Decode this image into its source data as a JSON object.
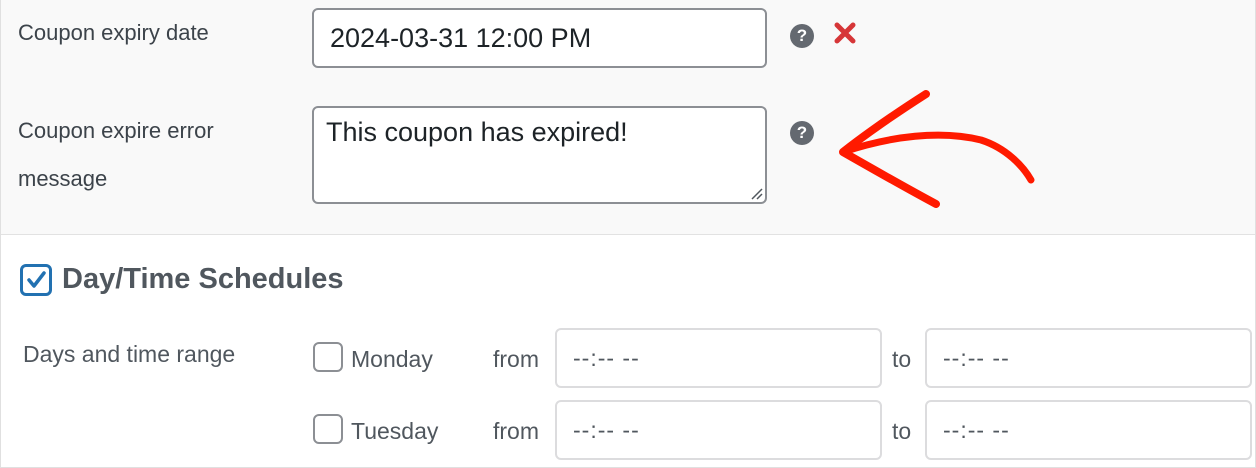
{
  "expiry": {
    "label": "Coupon expiry date",
    "value": "2024-03-31 12:00 PM",
    "help_icon": "question-circle-icon",
    "remove_icon": "red-x-icon"
  },
  "error_message": {
    "label_line1": "Coupon expire error",
    "label_line2": "message",
    "value": "This coupon has expired!",
    "help_icon": "question-circle-icon"
  },
  "schedule": {
    "title": "Day/Time Schedules",
    "enabled": true,
    "range_label": "Days and time range",
    "from_word": "from",
    "to_word": "to",
    "time_placeholder": "--:-- --",
    "days": [
      {
        "name": "Monday",
        "checked": false
      },
      {
        "name": "Tuesday",
        "checked": false
      }
    ]
  },
  "colors": {
    "accent": "#2271b1",
    "remove": "#d63638",
    "annotation_arrow": "#ff1a00"
  }
}
